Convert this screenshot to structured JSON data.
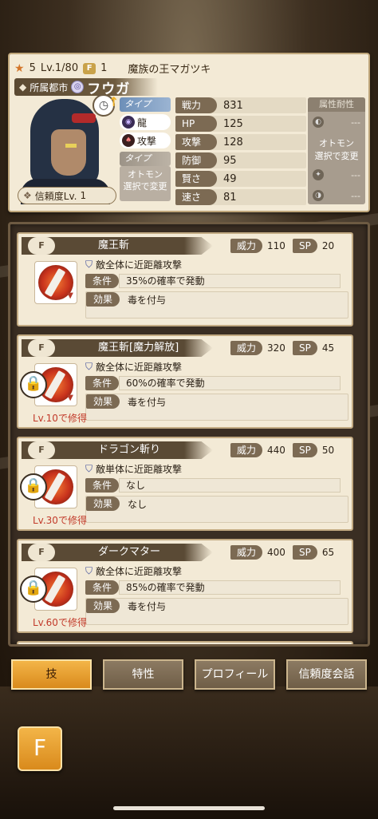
{
  "header": {
    "rarity": "5",
    "level": "Lv.1/80",
    "capsule_count": "1",
    "epithet": "魔族の王マガツキ",
    "affiliation_label": "所属都市",
    "name": "フウガ",
    "trust_label": "信頼度Lv.",
    "trust_level": "1"
  },
  "types": {
    "type_label": "タイプ",
    "type1": "龍",
    "type2": "攻撃",
    "otomon_type_label": "タイプ",
    "otomon_select": "オトモン\n選択で変更",
    "otomon_dash": "---"
  },
  "stats": [
    {
      "label": "戦力",
      "value": "831"
    },
    {
      "label": "HP",
      "value": "125"
    },
    {
      "label": "攻撃",
      "value": "128"
    },
    {
      "label": "防御",
      "value": "95"
    },
    {
      "label": "賢さ",
      "value": "49"
    },
    {
      "label": "速さ",
      "value": "81"
    }
  ],
  "attributes": {
    "header": "属性耐性",
    "dash": "---",
    "otomon_select": "オトモン\n選択で変更"
  },
  "skill_labels": {
    "power": "威力",
    "sp": "SP",
    "condition": "条件",
    "effect": "効果"
  },
  "skills": [
    {
      "name": "魔王斬",
      "power": "110",
      "sp": "20",
      "target": "敵全体に近距離攻撃",
      "condition": "35%の確率で発動",
      "effect": "毒を付与",
      "requirement": ""
    },
    {
      "name": "魔王斬[魔力解放]",
      "power": "320",
      "sp": "45",
      "target": "敵全体に近距離攻撃",
      "condition": "60%の確率で発動",
      "effect": "毒を付与",
      "requirement": "Lv.10で修得"
    },
    {
      "name": "ドラゴン斬り",
      "power": "440",
      "sp": "50",
      "target": "敵単体に近距離攻撃",
      "condition": "なし",
      "effect": "なし",
      "requirement": "Lv.30で修得"
    },
    {
      "name": "ダークマター",
      "power": "400",
      "sp": "65",
      "target": "敵全体に近距離攻撃",
      "condition": "85%の確率で発動",
      "effect": "毒を付与",
      "requirement": "Lv.60で修得"
    }
  ],
  "tabs": [
    "技",
    "特性",
    "プロフィール",
    "信頼度会話"
  ],
  "icons": {
    "tag": "F",
    "home": "F"
  }
}
